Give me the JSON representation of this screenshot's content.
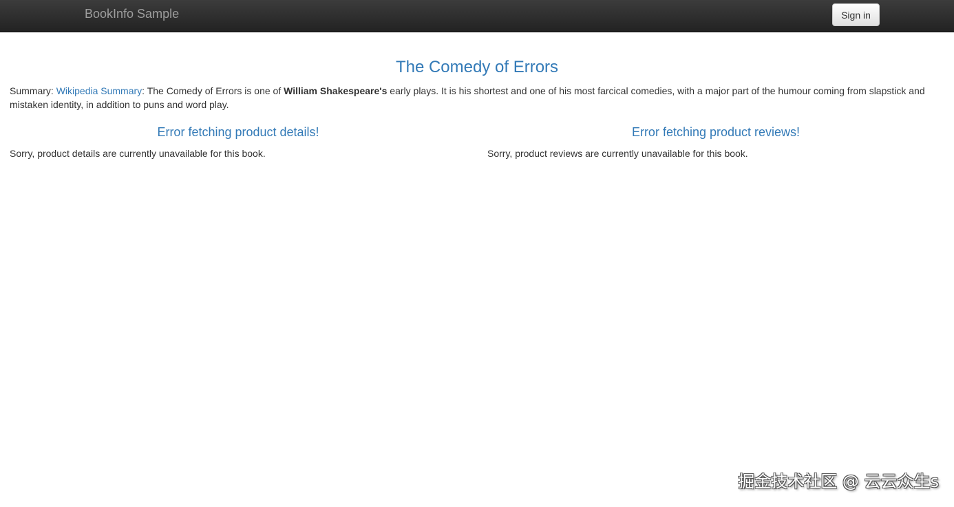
{
  "navbar": {
    "brand": "BookInfo Sample",
    "signin_label": "Sign in"
  },
  "book": {
    "title": "The Comedy of Errors",
    "summary_prefix": "Summary: ",
    "summary_link": "Wikipedia Summary",
    "summary_text_before": ": The Comedy of Errors is one of ",
    "summary_bold": "William Shakespeare's",
    "summary_text_after": " early plays. It is his shortest and one of his most farcical comedies, with a major part of the humour coming from slapstick and mistaken identity, in addition to puns and word play."
  },
  "details": {
    "heading": "Error fetching product details!",
    "message": "Sorry, product details are currently unavailable for this book."
  },
  "reviews": {
    "heading": "Error fetching product reviews!",
    "message": "Sorry, product reviews are currently unavailable for this book."
  },
  "watermark": {
    "text": "掘金技术社区 @ 云云众生s"
  }
}
